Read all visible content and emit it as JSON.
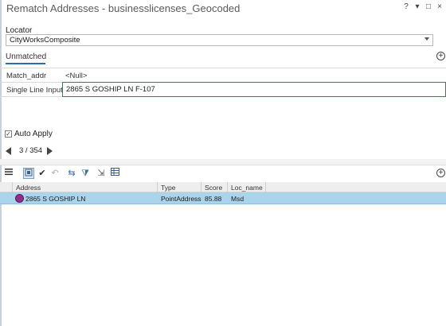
{
  "window": {
    "title": "Rematch Addresses - businesslicenses_Geocoded",
    "controls": [
      "?",
      "▾",
      "□",
      "×"
    ]
  },
  "locator": {
    "label": "Locator",
    "value": "CityWorksComposite"
  },
  "tab": {
    "label": "Unmatched"
  },
  "fields": {
    "match_addr": {
      "label": "Match_addr",
      "value": "<Null>"
    },
    "single_line": {
      "label": "Single Line Input",
      "value": "2865 S GOSHIP LN F-107"
    }
  },
  "auto_apply": {
    "label": "Auto Apply",
    "checked": true
  },
  "pager": {
    "text": "3 / 354"
  },
  "table": {
    "columns": [
      "Address",
      "Type",
      "Score",
      "Loc_name"
    ],
    "rows": [
      {
        "address": "2865 S GOSHIP LN",
        "type": "PointAddress",
        "score": "85.88",
        "loc_name": "Msd"
      }
    ]
  },
  "icons": {
    "menu": "hamburger-icon",
    "zoom_selected": "zoom-to-selected-icon",
    "accept": "checkmark-icon",
    "undo": "undo-icon",
    "pan": "pan-to-icon",
    "filter": "filter-icon",
    "select": "select-icon",
    "table": "table-icon",
    "add": "plus-circle-icon"
  },
  "colors": {
    "selection_row": "#aad3ec",
    "tab_underline": "#2a6ab0",
    "match_badge": "#8e2f8e"
  }
}
